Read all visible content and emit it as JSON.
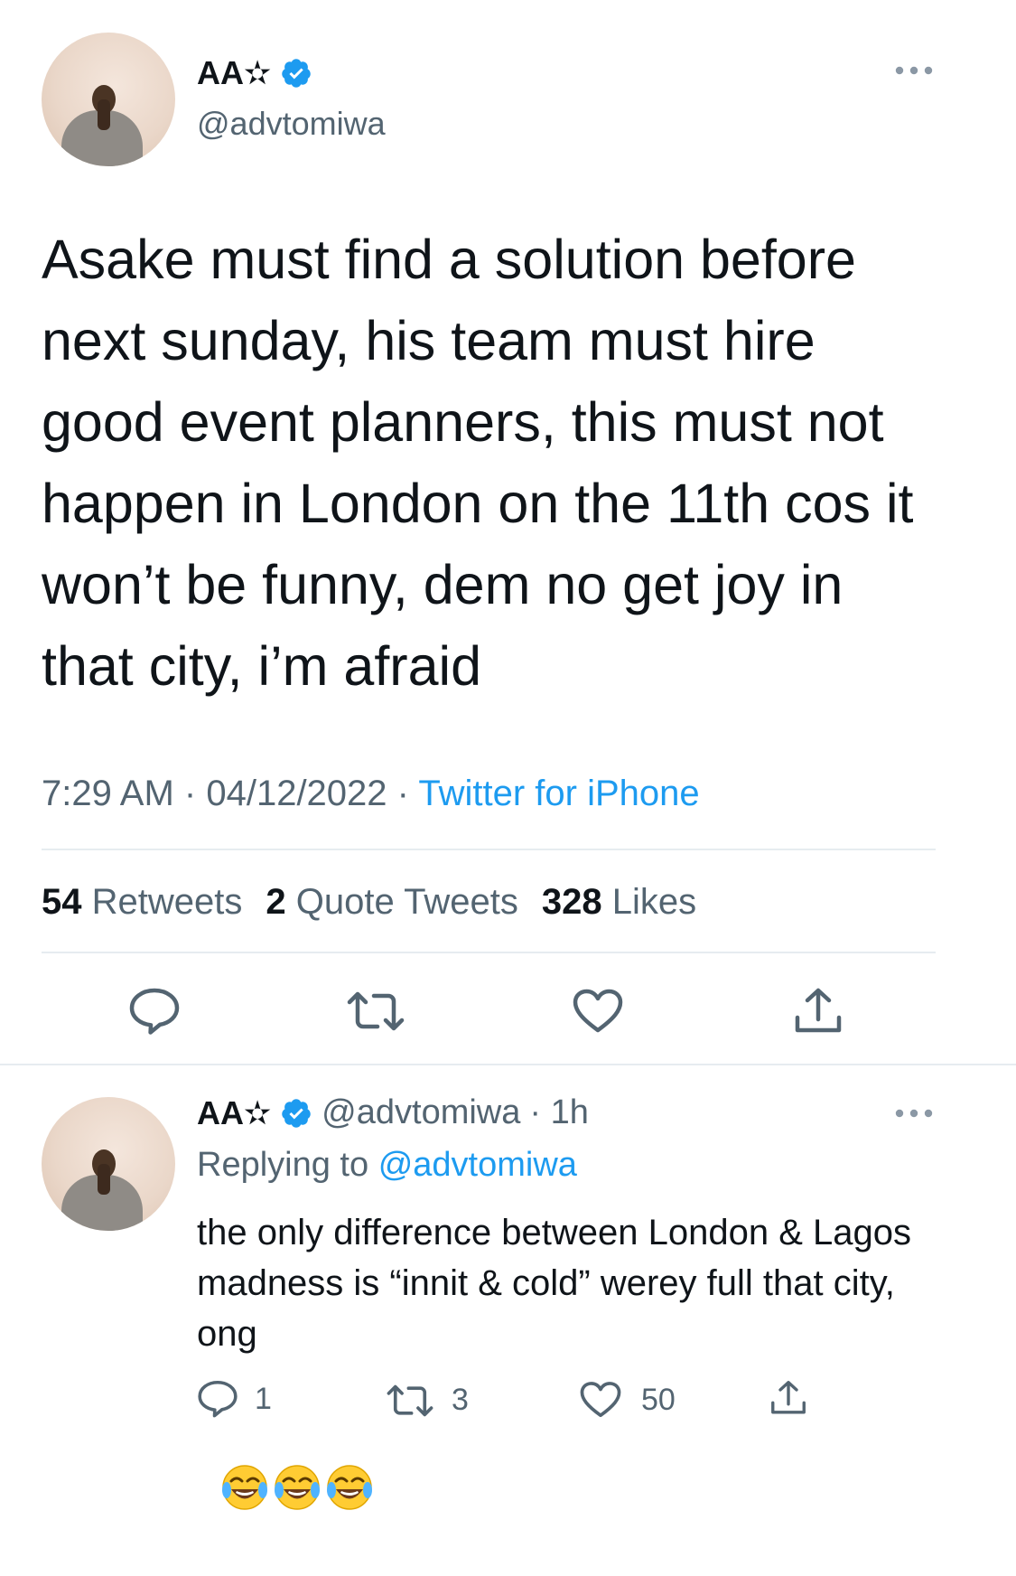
{
  "tweet": {
    "display_name": "AA✫",
    "handle": "@advtomiwa",
    "more_icon": "more-horizontal-icon",
    "text": "Asake must find a solution before next sunday, his team must hire good event planners, this must not happen in London on the 11th cos it won’t be funny, dem no get joy in that city, i’m afraid",
    "time": "7:29 AM",
    "date": "04/12/2022",
    "source": "Twitter for iPhone",
    "separator": "·",
    "stats": {
      "retweets_count": "54",
      "retweets_label": "Retweets",
      "quotes_count": "2",
      "quotes_label": "Quote Tweets",
      "likes_count": "328",
      "likes_label": "Likes"
    },
    "actions": [
      "reply-icon",
      "retweet-icon",
      "like-icon",
      "share-icon"
    ]
  },
  "reply": {
    "display_name": "AA✫",
    "handle": "@advtomiwa",
    "age": "· 1h",
    "replying_prefix": "Replying to",
    "replying_to": "@advtomiwa",
    "text": "the only difference between London & Lagos madness is “innit & cold” werey full that city, ong",
    "emoji_name": "face-with-tears-of-joy-emoji",
    "reply_count": "1",
    "retweet_count": "3",
    "like_count": "50"
  },
  "colors": {
    "accent": "#1d9bf0",
    "secondary_text": "#536471",
    "divider": "#e6ecf0"
  }
}
